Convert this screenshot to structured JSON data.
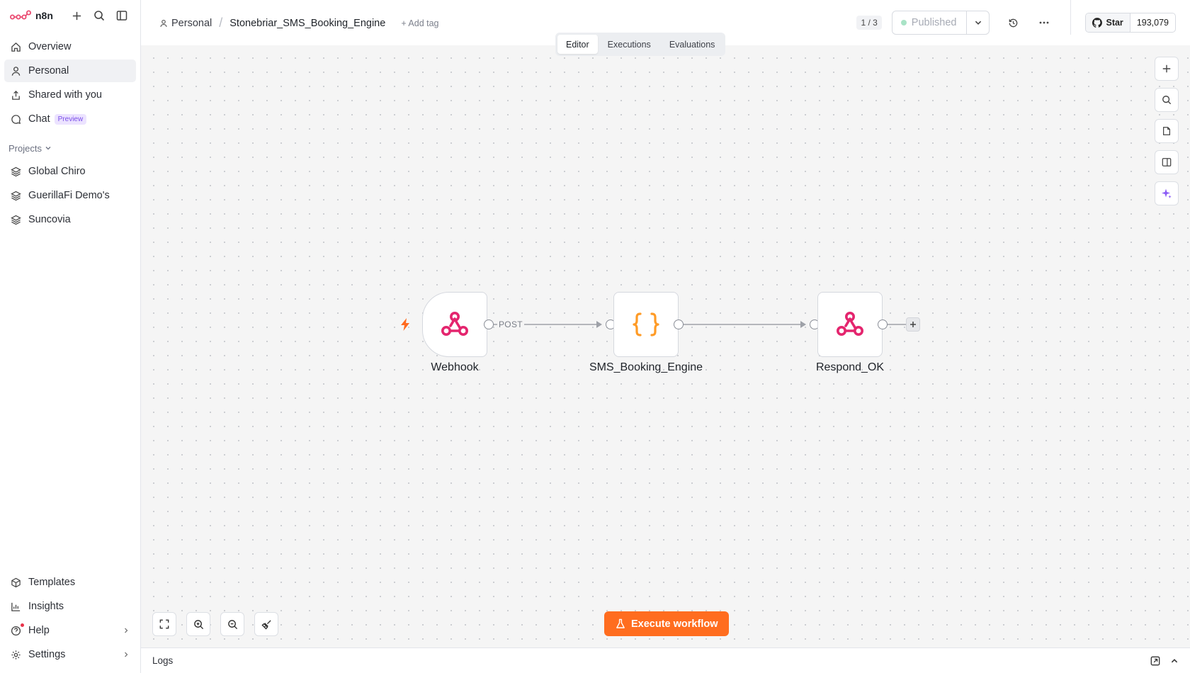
{
  "app": {
    "name": "n8n"
  },
  "sidebar": {
    "nav": [
      {
        "label": "Overview",
        "icon": "home-icon"
      },
      {
        "label": "Personal",
        "icon": "user-icon",
        "active": true
      },
      {
        "label": "Shared with you",
        "icon": "share-icon"
      },
      {
        "label": "Chat",
        "icon": "chat-icon",
        "badge": "Preview"
      }
    ],
    "projects_label": "Projects",
    "projects": [
      {
        "label": "Global Chiro",
        "icon": "layers-icon"
      },
      {
        "label": "GuerillaFi Demo's",
        "icon": "layers-icon"
      },
      {
        "label": "Suncovia",
        "icon": "layers-icon"
      }
    ],
    "bottom": [
      {
        "label": "Templates",
        "icon": "templates-icon"
      },
      {
        "label": "Insights",
        "icon": "chart-icon"
      },
      {
        "label": "Help",
        "icon": "help-icon"
      },
      {
        "label": "Settings",
        "icon": "gear-icon"
      }
    ]
  },
  "header": {
    "breadcrumb_home": "Personal",
    "workflow_title": "Stonebriar_SMS_Booking_Engine",
    "add_tag": "+ Add tag",
    "version": "1 / 3",
    "publish_label": "Published",
    "github": {
      "star_label": "Star",
      "count": "193,079"
    }
  },
  "tabs": [
    "Editor",
    "Executions",
    "Evaluations"
  ],
  "workflow": {
    "nodes": [
      {
        "name": "Webhook",
        "icon": "webhook-icon"
      },
      {
        "name": "SMS_Booking_Engine",
        "icon": "code-braces-icon"
      },
      {
        "name": "Respond_OK",
        "icon": "webhook-icon"
      }
    ],
    "edge_label": "POST"
  },
  "actions": {
    "execute": "Execute workflow"
  },
  "logs": {
    "label": "Logs"
  },
  "colors": {
    "accent": "#ff6d1f",
    "webhook": "#e4256e",
    "code": "#ff9b26",
    "preview_badge": "#7a4ee8"
  }
}
